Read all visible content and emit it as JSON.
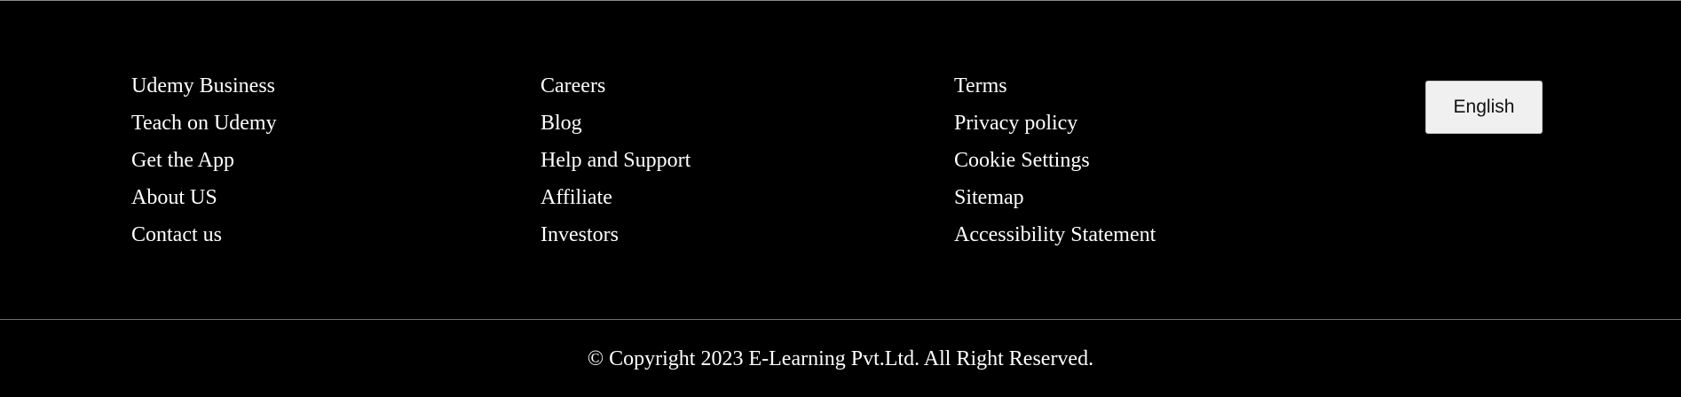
{
  "footer": {
    "columns": [
      {
        "links": [
          "Udemy Business",
          "Teach on Udemy",
          "Get the App",
          "About US",
          "Contact us"
        ]
      },
      {
        "links": [
          "Careers",
          "Blog",
          "Help and Support",
          "Affiliate",
          "Investors"
        ]
      },
      {
        "links": [
          "Terms",
          "Privacy policy",
          "Cookie Settings",
          "Sitemap",
          "Accessibility Statement"
        ]
      }
    ],
    "language_button": "English",
    "copyright": "© Copyright 2023 E-Learning Pvt.Ltd. All Right Reserved."
  },
  "colors": {
    "background": "#000000",
    "text": "#ffffff",
    "button_background": "#f0f0f0",
    "divider": "#6e6e6e"
  }
}
